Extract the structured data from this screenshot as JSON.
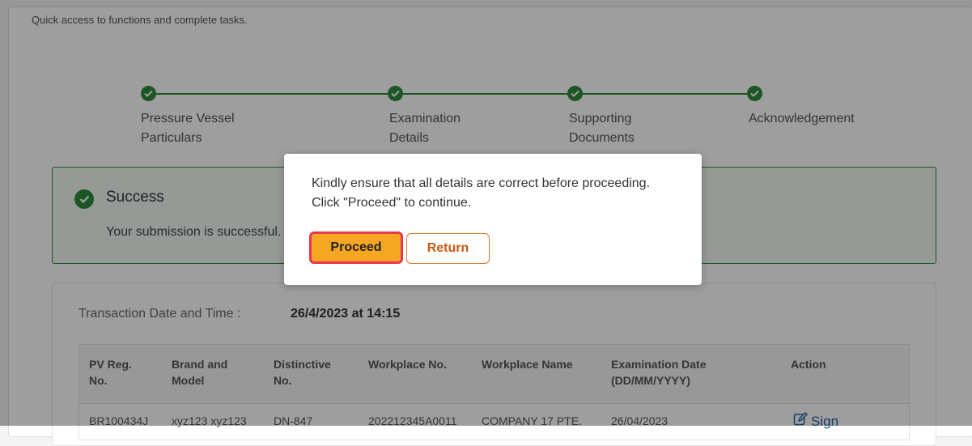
{
  "page": {
    "subtitle": "Quick access to functions and complete tasks."
  },
  "stepper": {
    "steps": [
      {
        "label_line1": "Pressure Vessel",
        "label_line2": "Particulars",
        "status": "complete"
      },
      {
        "label_line1": "Examination",
        "label_line2": "Details",
        "status": "complete"
      },
      {
        "label_line1": "Supporting",
        "label_line2": "Documents",
        "status": "complete"
      },
      {
        "label_line1": "Acknowledgement",
        "label_line2": "",
        "status": "complete"
      }
    ],
    "icon": "check-icon",
    "color": "#2e8b3a"
  },
  "success": {
    "icon": "check-circle-icon",
    "title": "Success",
    "message": "Your submission is successful."
  },
  "transaction": {
    "label": "Transaction Date and Time :",
    "value": "26/4/2023 at 14:15"
  },
  "table": {
    "headers": [
      [
        "PV Reg.",
        "No."
      ],
      [
        "Brand and",
        "Model"
      ],
      [
        "Distinctive",
        "No."
      ],
      [
        "Workplace No.",
        ""
      ],
      [
        "Workplace Name",
        ""
      ],
      [
        "Examination Date",
        "(DD/MM/YYYY)"
      ],
      [
        "Action",
        ""
      ]
    ],
    "rows": [
      {
        "pv_reg_no": "BR100434J",
        "brand_model": "xyz123 xyz123",
        "distinctive_no": "DN-847",
        "workplace_no": "202212345A0011",
        "workplace_name": "COMPANY 17 PTE.",
        "exam_date": "26/04/2023",
        "action": "Sign",
        "action_icon": "edit-icon"
      }
    ]
  },
  "modal": {
    "line1": "Kindly ensure that all details are correct before proceeding.",
    "line2": "Click \"Proceed\" to continue.",
    "proceed_label": "Proceed",
    "return_label": "Return",
    "proceed_color": "#f5a623",
    "highlight_color": "#e8384f",
    "return_color": "#c55a11"
  }
}
